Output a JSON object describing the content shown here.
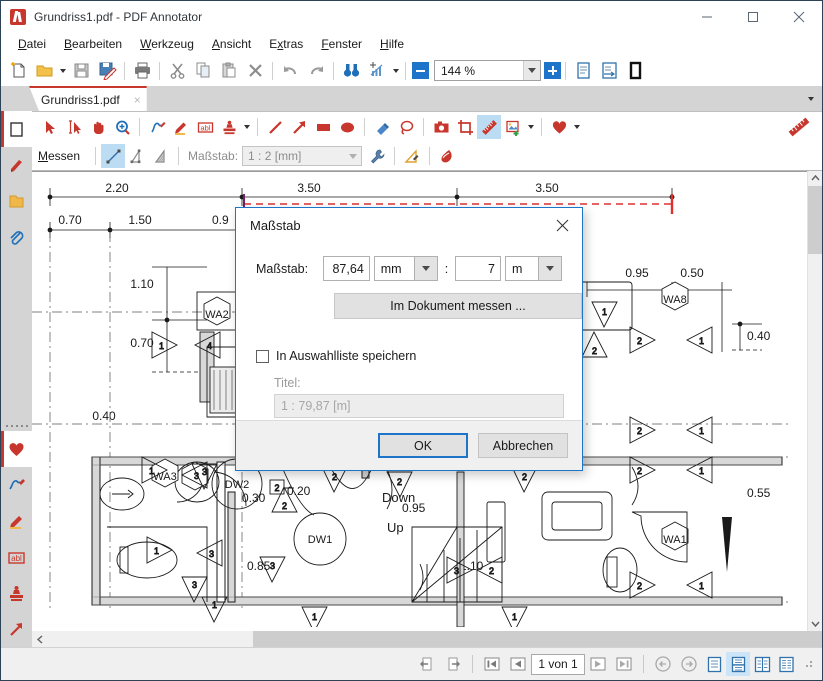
{
  "window": {
    "title": "Grundriss1.pdf - PDF Annotator",
    "app_icon": "pdf-annotator-logo",
    "minimize": "minimize-icon",
    "maximize": "maximize-icon",
    "close": "close-icon"
  },
  "menubar": [
    {
      "label": "Datei",
      "mnemonic": "D"
    },
    {
      "label": "Bearbeiten",
      "mnemonic": "B"
    },
    {
      "label": "Werkzeug",
      "mnemonic": "W"
    },
    {
      "label": "Ansicht",
      "mnemonic": "A"
    },
    {
      "label": "Extras",
      "mnemonic": "x"
    },
    {
      "label": "Fenster",
      "mnemonic": "F"
    },
    {
      "label": "Hilfe",
      "mnemonic": "H"
    }
  ],
  "toolbar": {
    "items": [
      {
        "name": "new-document-icon"
      },
      {
        "name": "open-folder-icon"
      },
      {
        "name": "save-icon"
      },
      {
        "name": "save-as-icon"
      },
      {
        "name": "print-icon"
      },
      {
        "name": "cut-scissors-icon"
      },
      {
        "name": "copy-icon"
      },
      {
        "name": "paste-icon"
      },
      {
        "name": "delete-x-icon"
      },
      {
        "name": "undo-icon"
      },
      {
        "name": "redo-icon"
      },
      {
        "name": "find-binoculars-icon"
      },
      {
        "name": "page-setup-icon"
      }
    ],
    "zoom_value": "144 %",
    "zoom_out": "zoom-out-icon",
    "zoom_in": "zoom-in-icon",
    "view_single_page": "single-page-icon",
    "view_continuous": "continuous-page-icon",
    "view_fullscreen": "fullscreen-icon"
  },
  "tabs": [
    {
      "label": "Grundriss1.pdf",
      "close": "×",
      "active": true
    }
  ],
  "tabstrip": {
    "overflow": "chevron-down-icon"
  },
  "left_rail": [
    {
      "name": "page-thumbnail-panel",
      "icon": "page-icon",
      "selected": true
    },
    {
      "name": "bookmark-panel",
      "icon": "bookmark-ribbon-icon",
      "selected": false
    },
    {
      "name": "documents-panel",
      "icon": "folder-icon",
      "selected": false
    },
    {
      "name": "attachments-panel",
      "icon": "paperclip-icon",
      "selected": false
    },
    {
      "name": "favorites-panel",
      "icon": "heart-icon",
      "selected": true
    },
    {
      "name": "pen-tool",
      "icon": "pen-squiggle-icon",
      "selected": false
    },
    {
      "name": "highlighter-tool",
      "icon": "highlighter-icon",
      "selected": false
    },
    {
      "name": "text-tool",
      "icon": "abl-text-icon",
      "selected": false
    },
    {
      "name": "stamp-tool",
      "icon": "stamp-icon",
      "selected": false
    },
    {
      "name": "arrow-tool",
      "icon": "arrow-icon",
      "selected": false
    }
  ],
  "annotation_toolbar": {
    "tools": [
      {
        "name": "select-arrow-tool",
        "icon": "cursor-arrow-icon",
        "active": false
      },
      {
        "name": "text-select-tool",
        "icon": "text-select-icon",
        "active": false
      },
      {
        "name": "pan-hand-tool",
        "icon": "hand-icon",
        "active": false
      },
      {
        "name": "zoom-tool",
        "icon": "magnifier-plus-icon",
        "active": false
      },
      {
        "name": "pen-tool",
        "icon": "pen-squiggle-icon",
        "active": false
      },
      {
        "name": "highlighter-tool",
        "icon": "highlighter-icon",
        "active": false
      },
      {
        "name": "text-box-tool",
        "icon": "abl-text-icon",
        "active": false
      },
      {
        "name": "stamp-tool",
        "icon": "stamp-icon",
        "active": false
      },
      {
        "name": "line-tool",
        "icon": "line-icon",
        "active": false
      },
      {
        "name": "arrow-tool",
        "icon": "arrow-icon",
        "active": false
      },
      {
        "name": "rectangle-tool",
        "icon": "filled-rectangle-icon",
        "active": false
      },
      {
        "name": "ellipse-tool",
        "icon": "filled-ellipse-icon",
        "active": false
      },
      {
        "name": "eraser-tool",
        "icon": "eraser-icon",
        "active": false
      },
      {
        "name": "lasso-tool",
        "icon": "lasso-icon",
        "active": false
      },
      {
        "name": "snapshot-tool",
        "icon": "camera-icon",
        "active": false
      },
      {
        "name": "crop-tool",
        "icon": "crop-icon",
        "active": false
      },
      {
        "name": "measure-tool",
        "icon": "ruler-icon",
        "active": true
      },
      {
        "name": "insert-image-tool",
        "icon": "insert-image-icon",
        "active": false
      },
      {
        "name": "favorites-tool",
        "icon": "heart-icon",
        "active": false
      }
    ],
    "right_tool": {
      "name": "ruler-tool",
      "icon": "ruler-icon"
    }
  },
  "measure_bar": {
    "label": "Messen",
    "mnemonic": "M",
    "tools": [
      {
        "name": "measure-distance-tool",
        "icon": "diagonal-line-icon",
        "active": true
      },
      {
        "name": "measure-perimeter-tool",
        "icon": "polyline-icon",
        "active": false
      },
      {
        "name": "measure-area-tool",
        "icon": "area-triangle-icon",
        "active": false
      }
    ],
    "scale_label": "Maßstab:",
    "scale_value": "1 : 2 [mm]",
    "settings_icon": "wrench-icon",
    "calibrate_icon": "calibrate-triangle-icon",
    "ink_icon": "ink-drop-icon"
  },
  "dialog": {
    "title": "Maßstab",
    "close_icon": "close-icon",
    "scale_label": "Maßstab:",
    "value_left": "87,64",
    "unit_left": "mm",
    "separator": ":",
    "value_right": "7",
    "unit_right": "m",
    "measure_button": "Im Dokument messen ...",
    "checkbox_label": "In Auswahlliste speichern",
    "checkbox_checked": false,
    "title_field_label": "Titel:",
    "title_field_value": "1 : 79,87 [m]",
    "ok_button": "OK",
    "cancel_button": "Abbrechen",
    "accent_color": "#1e74c8"
  },
  "statusbar": {
    "prev_view_icon": "previous-view-icon",
    "next_view_icon": "next-view-icon",
    "first_page_icon": "first-page-icon",
    "prev_page_icon": "previous-page-icon",
    "page_value": "1 von 1",
    "next_page_icon": "next-page-icon",
    "last_page_icon": "last-page-icon",
    "back_icon": "back-arrow-icon",
    "forward_icon": "forward-arrow-icon",
    "layouts": [
      {
        "name": "layout-single-page",
        "icon": "single-page-layout-icon",
        "active": false
      },
      {
        "name": "layout-continuous",
        "icon": "continuous-layout-icon",
        "active": true
      },
      {
        "name": "layout-facing",
        "icon": "facing-pages-layout-icon",
        "active": false
      },
      {
        "name": "layout-columns",
        "icon": "column-layout-icon",
        "active": false
      }
    ],
    "resize_grip": "resize-grip-icon"
  },
  "document": {
    "name": "floorplan-drawing",
    "top_dimensions": [
      "2.20",
      "3.50",
      "3.50"
    ],
    "second_row_dimensions": [
      "0.70",
      "1.50",
      "0.9"
    ],
    "left_dimensions": [
      "1.10",
      "0.70",
      "0.40"
    ],
    "right_dimensions": [
      "0.95",
      "0.50",
      "0.40",
      "0.55"
    ],
    "interior_dimensions": [
      "0.30",
      "0.20",
      "0.85",
      "0.95",
      "1.10"
    ],
    "room_labels": [
      "WA2",
      "WA3",
      "WA8",
      "WA1",
      "DW1",
      "DW2"
    ],
    "stair_labels": [
      "Down",
      "Up"
    ]
  }
}
